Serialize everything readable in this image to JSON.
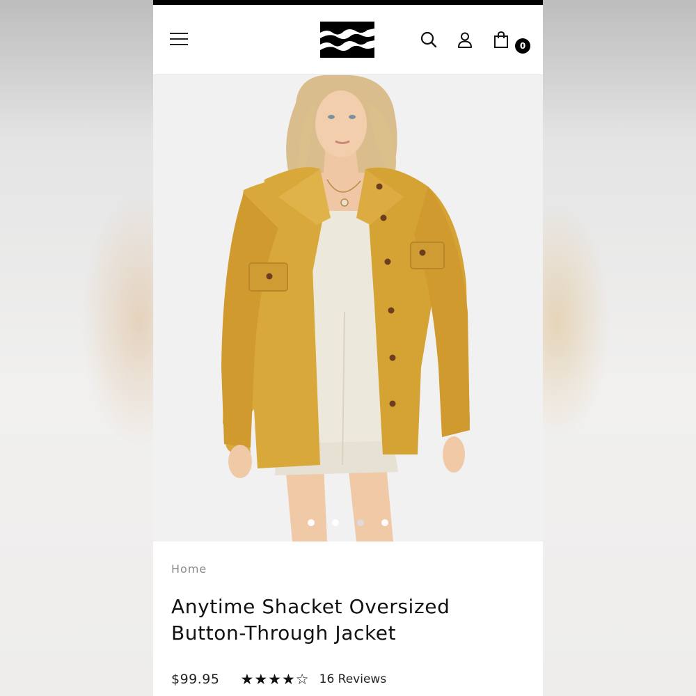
{
  "header": {
    "cart_count": "0"
  },
  "hero": {
    "slide_count": 4,
    "active_slide": 1
  },
  "product": {
    "breadcrumb": "Home",
    "title_line1": "Anytime Shacket Oversized",
    "title_line2": "Button-Through Jacket",
    "price": "$99.95",
    "rating": 4,
    "rating_max": 5,
    "reviews_label": "16 Reviews"
  },
  "colors": {
    "jacket": "#d9a83a",
    "accent_black": "#000000"
  }
}
